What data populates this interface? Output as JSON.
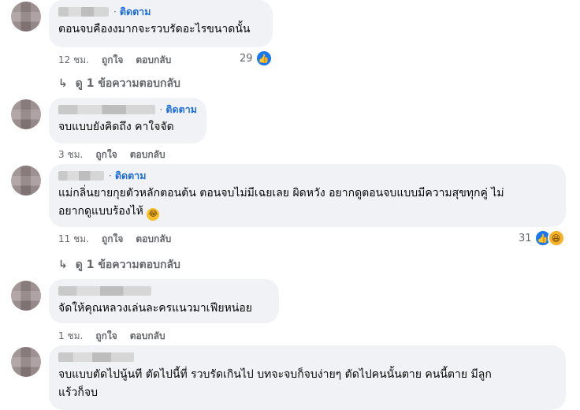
{
  "comments": [
    {
      "follow": "ติดตาม",
      "text": "ตอนจบคืองงมากจะรวบรัดอะไรขนาดนั้น",
      "time": "12 ชม.",
      "like": "ถูกใจ",
      "reply": "ตอบกลับ",
      "reaction_count": "29",
      "reply_link": "ดู 1 ข้อความตอบกลับ"
    },
    {
      "follow": "ติดตาม",
      "text": "จบแบบยังคิดถึง คาใจจัด",
      "time": "3 ชม.",
      "like": "ถูกใจ",
      "reply": "ตอบกลับ"
    },
    {
      "follow": "ติดตาม",
      "text": "แม่กลิ่นยายกุยตัวหลักตอนต้น ตอนจบไม่มีเฉยเลย ผิดหวัง อยากดูตอนจบแบบมีความสุขทุกคู่ ไม่",
      "text2": "อยากดูแบบร้องไห้",
      "time": "11 ชม.",
      "like": "ถูกใจ",
      "reply": "ตอบกลับ",
      "reaction_count": "31",
      "reply_link": "ดู 1 ข้อความตอบกลับ"
    },
    {
      "text": "จัดให้คุณหลวงเล่นละครแนวมาเฟียหน่อย",
      "time": "1 ชม.",
      "like": "ถูกใจ",
      "reply": "ตอบกลับ"
    },
    {
      "text": "จบแบบตัดไปนู้นที ตัดไปนี้ที่ รวบรัดเกินไป บทจะจบก็จบง่ายๆ ตัดไปคนนั้นตาย คนนี้ตาย มีลูก",
      "text2": "แร้วก็จบ"
    }
  ],
  "icons": {
    "like": "thumbs-up-icon",
    "haha": "haha-icon",
    "reply_arrow": "reply-arrow-icon"
  },
  "colors": {
    "follow": "#216fdb",
    "bubble": "#f0f2f5",
    "meta": "#65676b",
    "like_blue": "#1877f2"
  }
}
